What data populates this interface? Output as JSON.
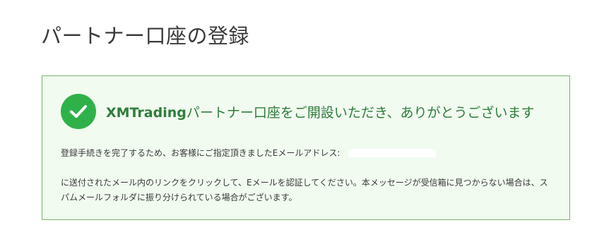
{
  "page": {
    "title": "パートナー口座の登録"
  },
  "success": {
    "brand": "XMTrading",
    "heading_rest": "パートナー口座をご開設いただき、ありがとうございます",
    "line1": "登録手続きを完了するため、お客様にご指定頂きましたEメールアドレス:",
    "paragraph": "に送付されたメール内のリンクをクリックして、Eメールを認証してください。本メッセージが受信箱に見つからない場合は、スパムメールフォルダに振り分けられている場合がございます。",
    "icon": "check-circle-icon",
    "colors": {
      "accent": "#2fb14a",
      "heading": "#2f7d3a",
      "box_background": "#f1fbf0",
      "box_border": "#7cb36f"
    }
  }
}
